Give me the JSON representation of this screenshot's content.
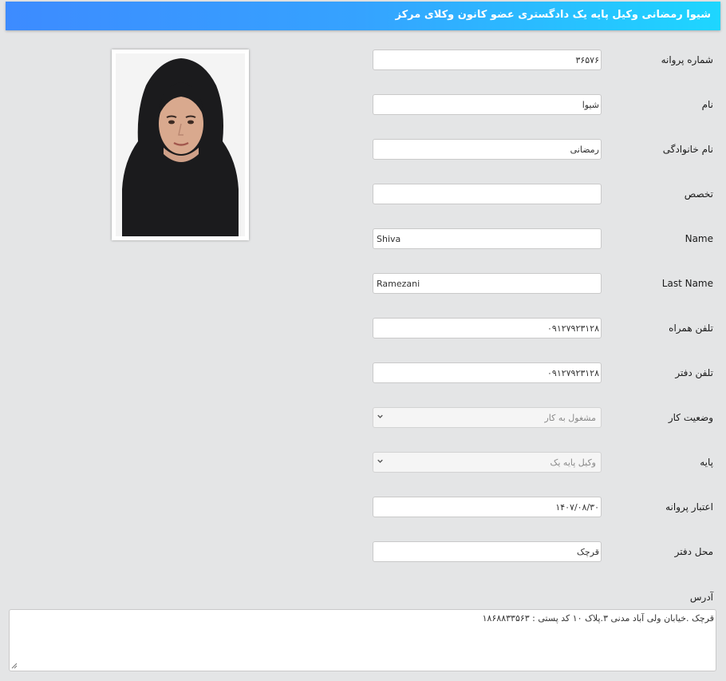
{
  "header": {
    "title": "شیوا رمضانی وکیل پایه یک دادگستری عضو کانون وکلای مرکز"
  },
  "form": {
    "license_number": {
      "label": "شماره پروانه",
      "value": "۳۶۵۷۶"
    },
    "first_name": {
      "label": "نام",
      "value": "شیوا"
    },
    "last_name": {
      "label": "نام خانوادگی",
      "value": "رمضانی"
    },
    "specialty": {
      "label": "تخصص",
      "value": ""
    },
    "name_en": {
      "label": "Name",
      "value": "Shiva"
    },
    "last_name_en": {
      "label": "Last Name",
      "value": "Ramezani"
    },
    "mobile": {
      "label": "تلفن همراه",
      "value": "۰۹۱۲۷۹۲۳۱۲۸"
    },
    "office_phone": {
      "label": "تلفن دفتر",
      "value": "۰۹۱۲۷۹۲۳۱۲۸"
    },
    "work_status": {
      "label": "وضعیت کار",
      "value": "مشغول به کار"
    },
    "grade": {
      "label": "پایه",
      "value": "وکیل پایه یک"
    },
    "license_validity": {
      "label": "اعتبار پروانه",
      "value": "۱۴۰۷/۰۸/۳۰"
    },
    "office_location": {
      "label": "محل دفتر",
      "value": "قرچک"
    },
    "address": {
      "label": "آدرس",
      "value": "قرچک .خیابان ولی آباد مدنی ۳.پلاک ۱۰ کد پستی : ۱۸۶۸۸۳۳۵۶۳"
    }
  },
  "icons": {
    "select_arrow": "chevron-down-icon",
    "resize": "resize-handle-icon"
  },
  "colors": {
    "header_start": "#3d8bff",
    "header_end": "#1ed6ff",
    "background": "#e4e5e6"
  }
}
